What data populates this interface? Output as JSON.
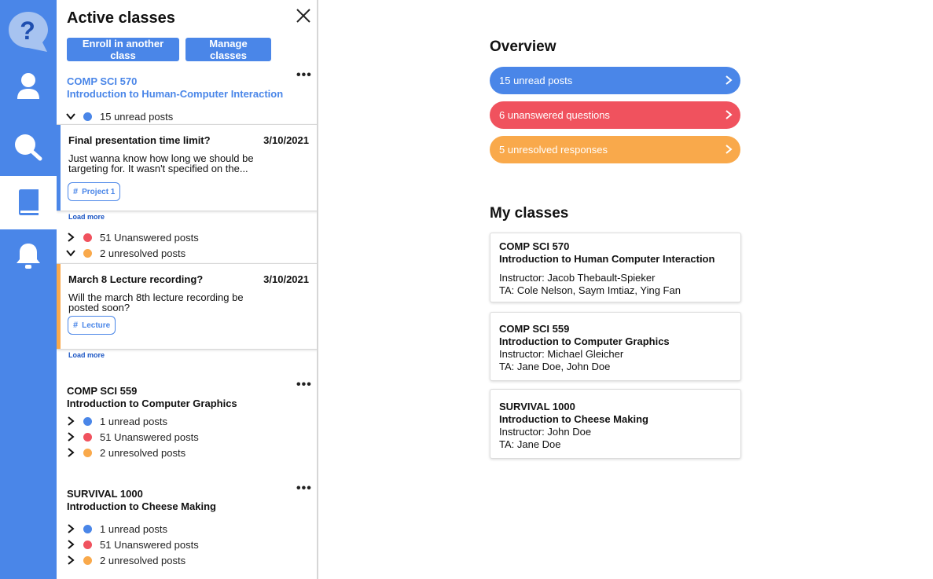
{
  "colors": {
    "primary": "#4a86e8",
    "unread": "#4a86e8",
    "unanswered": "#f0525e",
    "unresolved": "#f9a94b"
  },
  "rail": {
    "items": [
      {
        "name": "help-icon"
      },
      {
        "name": "profile-icon"
      },
      {
        "name": "search-icon"
      },
      {
        "name": "book-icon",
        "active": true
      },
      {
        "name": "bell-icon"
      }
    ]
  },
  "panel": {
    "title": "Active classes",
    "enroll_label": "Enroll in another class",
    "manage_label": "Manage classes",
    "courses": [
      {
        "code": "COMP SCI 570",
        "name": "Introduction to Human-Computer Interaction",
        "rows": [
          {
            "label": "15 unread posts",
            "expanded": true
          },
          {
            "label": "51 Unanswered posts",
            "expanded": false
          },
          {
            "label": "2 unresolved posts",
            "expanded": true
          }
        ],
        "unread_post": {
          "title": "Final presentation time limit?",
          "date": "3/10/2021",
          "body": "Just wanna know how long we should be targeting for. It wasn't specified on the...",
          "tag": "Project 1"
        },
        "unresolved_post": {
          "title": "March 8 Lecture recording?",
          "date": "3/10/2021",
          "body": "Will the march 8th lecture recording be posted soon?",
          "tag": "Lecture"
        },
        "load_more": "Load more"
      },
      {
        "code": "COMP SCI 559",
        "name": "Introduction to Computer Graphics",
        "rows": [
          {
            "label": "1 unread posts"
          },
          {
            "label": "51 Unanswered posts"
          },
          {
            "label": "2 unresolved posts"
          }
        ]
      },
      {
        "code": "SURVIVAL 1000",
        "name": "Introduction to Cheese Making",
        "rows": [
          {
            "label": "1 unread posts"
          },
          {
            "label": "51 Unanswered posts"
          },
          {
            "label": "2 unresolved posts"
          }
        ]
      }
    ]
  },
  "overview": {
    "title": "Overview",
    "pills": [
      {
        "label": "15 unread posts"
      },
      {
        "label": "6 unanswered questions"
      },
      {
        "label": "5 unresolved responses"
      }
    ]
  },
  "my_classes": {
    "title": "My classes",
    "cards": [
      {
        "code": "COMP SCI 570",
        "name": "Introduction to Human Computer Interaction",
        "instructor": "Instructor: Jacob Thebault-Spieker",
        "ta": "TA: Cole Nelson, Saym Imtiaz, Ying Fan"
      },
      {
        "code": "COMP SCI 559",
        "name": "Introduction to Computer Graphics",
        "instructor": "Instructor: Michael Gleicher",
        "ta": "TA: Jane Doe, John Doe"
      },
      {
        "code": "SURVIVAL 1000",
        "name": "Introduction to Cheese Making",
        "instructor": "Instructor: John Doe",
        "ta": "TA: Jane Doe"
      }
    ]
  }
}
